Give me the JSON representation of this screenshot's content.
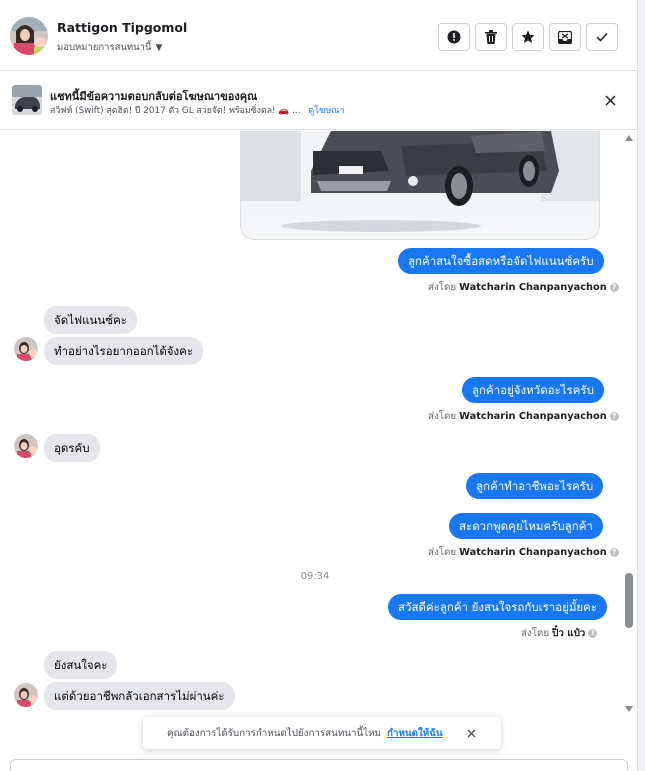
{
  "header": {
    "contact_name": "Rattigon Tipgomol",
    "assign_label": "มอบหมายการสนทนานี้",
    "actions": [
      "report-icon",
      "trash-icon",
      "star-icon",
      "inbox-move-icon",
      "check-icon"
    ]
  },
  "ad_context": {
    "title": "แชทนี้มีข้อความตอบกลับต่อโฆษณาของคุณ",
    "summary": "สวิฟท์ (Swift) สุดฮิต! ปี 2017 ตัว GL สวยจัด! พร้อมซิ่งดล! 🚗 ...",
    "view_ad_link": "ดูโฆษณา"
  },
  "conversation": {
    "messages": [
      {
        "dir": "out",
        "text": "ลูกค้าสนใจซื้อสดหรือจัดไฟแนนซ์ครับ"
      },
      {
        "dir": "meta",
        "prefix": "ส่งโดย",
        "sender": "Watcharin Chanpanyachon"
      },
      {
        "dir": "in",
        "text": "จัดไฟแนนซ์คะ"
      },
      {
        "dir": "in",
        "text": "ทำอย่างไรอยากออกได้จังคะ"
      },
      {
        "dir": "out",
        "text": "ลูกค้าอยู่จังหวัดอะไรครับ"
      },
      {
        "dir": "meta",
        "prefix": "ส่งโดย",
        "sender": "Watcharin Chanpanyachon"
      },
      {
        "dir": "in",
        "text": "อุดรคับ"
      },
      {
        "dir": "out",
        "text": "ลูกค้าทำอาชีพอะไรครับ"
      },
      {
        "dir": "out",
        "text": "สะดวกพูดคุยไหมครับลูกค้า"
      },
      {
        "dir": "meta",
        "prefix": "ส่งโดย",
        "sender": "Watcharin Chanpanyachon"
      },
      {
        "dir": "time",
        "text": "09:34"
      },
      {
        "dir": "out",
        "text": "สวัสดีค่ะลูกค้า ยังสนใจรถกับเราอยู่มั้ยคะ"
      },
      {
        "dir": "meta",
        "prefix": "ส่งโดย",
        "sender": "ปิ๋ว แป๋ว"
      },
      {
        "dir": "in",
        "text": "ยังสนใจคะ"
      },
      {
        "dir": "in",
        "text": "แต่ด้วยอาชีพกลัวเอกสารไม่ผ่านค่ะ"
      }
    ]
  },
  "toast": {
    "text": "คุณต้องการได้รับการกำหนดไปยังการสนทนานี้ไหม",
    "link": "กำหนดให้ฉัน"
  },
  "colors": {
    "accent": "#1877f2",
    "bubble_in": "#e4e6eb",
    "muted_text": "#65676b"
  },
  "scroll": {
    "position": 0.82
  }
}
